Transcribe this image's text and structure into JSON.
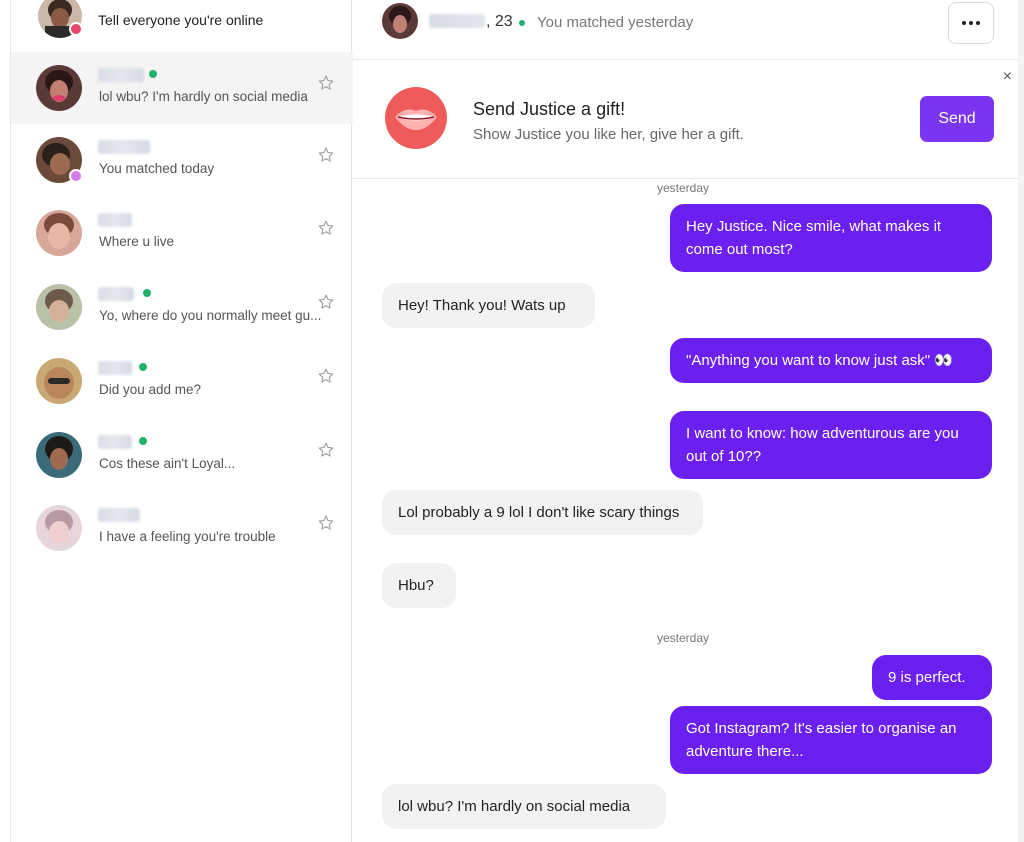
{
  "sidebar": {
    "online_prompt": "Tell everyone you're online",
    "contacts": [
      {
        "preview": "lol wbu? I'm hardly on social media",
        "online": true,
        "active": true
      },
      {
        "preview": "You matched today",
        "online": false,
        "active": false
      },
      {
        "preview": "Where u live",
        "online": false,
        "active": false
      },
      {
        "preview": "Yo, where do you normally meet gu...",
        "online": true,
        "active": false
      },
      {
        "preview": "Did you add me?",
        "online": true,
        "active": false
      },
      {
        "preview": "Cos these ain't Loyal...",
        "online": true,
        "active": false
      },
      {
        "preview": "I have a feeling you're trouble",
        "online": false,
        "active": false
      }
    ]
  },
  "header": {
    "age": ", 23",
    "matched": "You matched yesterday"
  },
  "gift": {
    "title": "Send Justice a gift!",
    "subtitle": "Show Justice you like her, give her a gift.",
    "send_label": "Send",
    "close_label": "×"
  },
  "messages": {
    "day1": "yesterday",
    "m1": "Hey Justice. Nice smile, what makes it come out most?",
    "m2": "Hey! Thank you! Wats up",
    "m3": "\"Anything you want to know just ask\" 👀",
    "m4": "I want to know: how adventurous are you out of 10??",
    "m5": "Lol probably a 9 lol I don't like scary things",
    "m6": "Hbu?",
    "day2": "yesterday",
    "m7": "9 is perfect.",
    "m8": "Got Instagram? It's easier to organise an adventure there...",
    "m9": "lol wbu? I'm hardly on social media"
  },
  "colors": {
    "accent": "#7b34f0",
    "outgoing_bubble": "#6b1ff0",
    "incoming_bubble": "#f2f2f2",
    "online": "#20b26b",
    "active_row": "#f4f4f4"
  },
  "icons": [
    "star-icon",
    "more-icon",
    "close-icon",
    "lips-icon",
    "online-dot-icon"
  ]
}
